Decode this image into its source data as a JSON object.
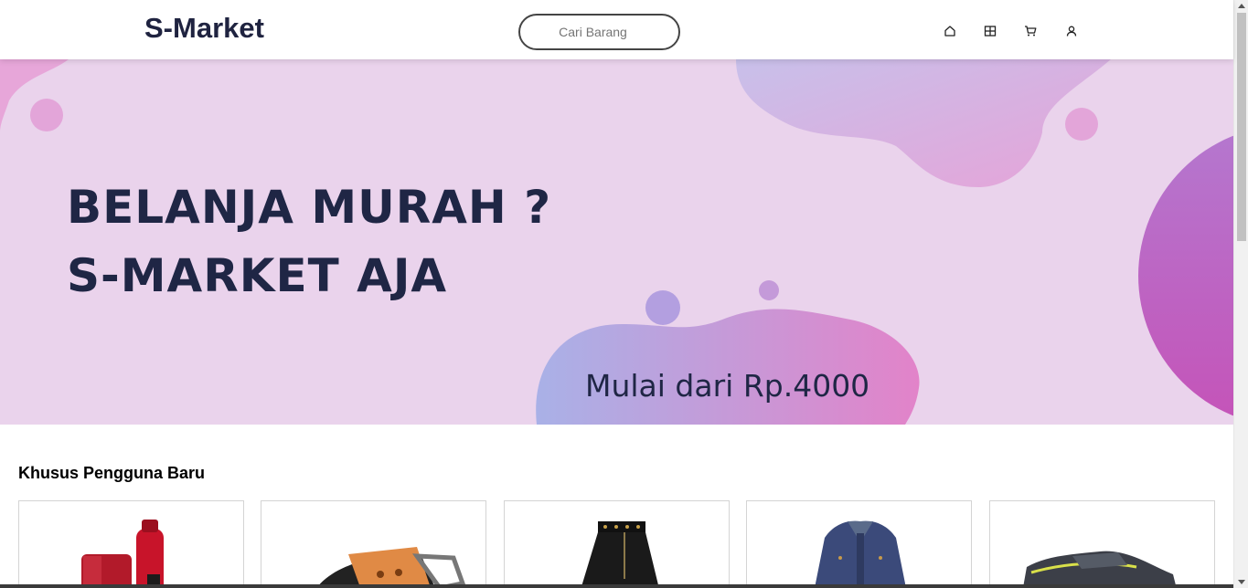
{
  "header": {
    "brand": "S-Market",
    "search_placeholder": "Cari Barang",
    "nav_icons": [
      "home-icon",
      "grid-icon",
      "cart-icon",
      "user-icon"
    ]
  },
  "hero": {
    "line1": "BELANJA MURAH ?",
    "line2": "S-MARKET AJA",
    "subtitle": "Mulai dari Rp.4000",
    "colors": {
      "background": "#ead3ec",
      "text": "#1f2645",
      "blob_pink": "#e38bcf",
      "blob_blue": "#a8b0e6",
      "blob_purple": "#b96cc8"
    }
  },
  "section": {
    "title": "Khusus Pengguna Baru",
    "products": [
      {
        "image": "red-bottles-image"
      },
      {
        "image": "leather-belt-image"
      },
      {
        "image": "black-skirt-image"
      },
      {
        "image": "denim-jacket-image"
      },
      {
        "image": "sneaker-shoe-image"
      }
    ]
  }
}
